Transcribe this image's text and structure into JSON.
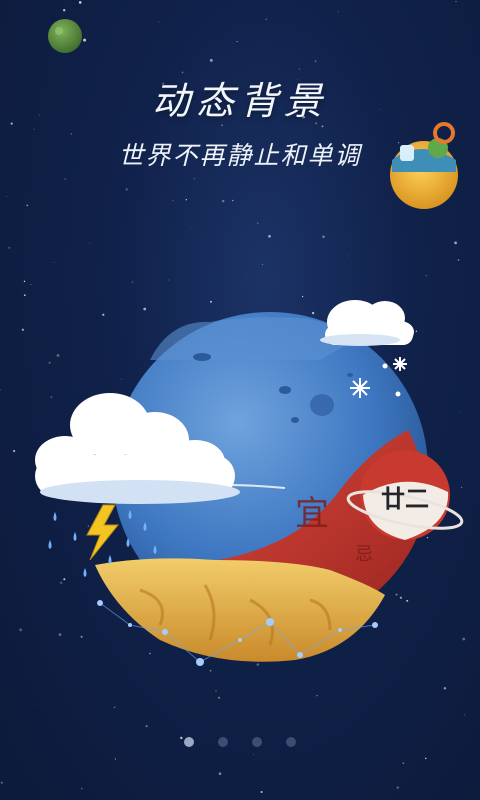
{
  "headline": "动态背景",
  "tagline": "世界不再静止和单调",
  "badge": {
    "day_label": "廿二",
    "omen_good": "宜",
    "omen_bad": "忌"
  },
  "pager": {
    "pages": 4,
    "active_index": 0
  },
  "icons": [
    "green-planet-icon",
    "small-island-planet-icon",
    "snowflake-icon",
    "lightning-icon",
    "cloud-icon"
  ],
  "colors": {
    "background": "#10214a",
    "planet_blue": "#3f78c2",
    "planet_red": "#c8392f",
    "planet_gold": "#e6b84a"
  }
}
